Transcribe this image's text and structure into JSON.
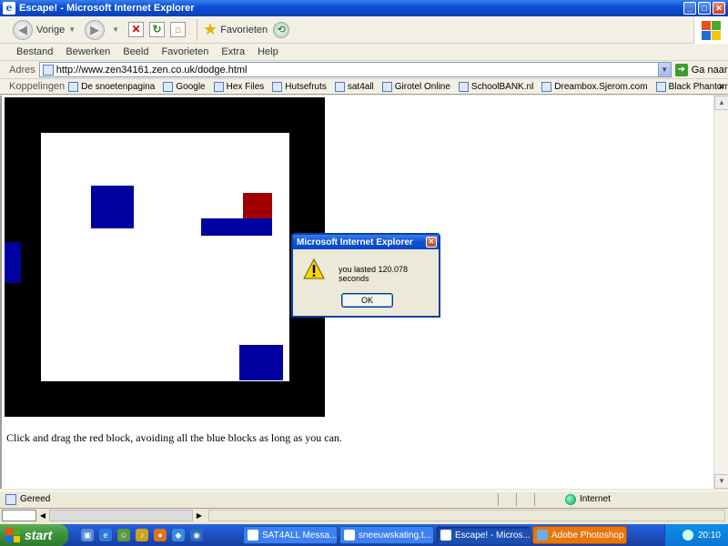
{
  "window": {
    "title": "Escape! - Microsoft Internet Explorer"
  },
  "toolbar": {
    "back_label": "Vorige",
    "favorites_label": "Favorieten"
  },
  "menu": [
    "Bestand",
    "Bewerken",
    "Beeld",
    "Favorieten",
    "Extra",
    "Help"
  ],
  "address": {
    "label": "Adres",
    "url": "http://www.zen34161.zen.co.uk/dodge.html",
    "go_label": "Ga naar"
  },
  "links": {
    "label": "Koppelingen",
    "items": [
      "De snoetenpagina",
      "Google",
      "Hex Files",
      "Hutsefruts",
      "sat4all",
      "Girotel Online",
      "SchoolBANK.nl",
      "Dreambox.Sjerom.com",
      "Black Phantom's Subtitles"
    ],
    "more": "»"
  },
  "page": {
    "instructions": "Click and drag the red block, avoiding all the blue blocks as long as you can."
  },
  "game": {
    "colors": {
      "frame": "#000000",
      "arena": "#ffffff",
      "enemy": "#0000a0",
      "player": "#a00000"
    }
  },
  "dialog": {
    "title": "Microsoft Internet Explorer",
    "message": "you lasted 120.078 seconds",
    "ok_label": "OK"
  },
  "status": {
    "text": "Gereed",
    "zone": "Internet"
  },
  "taskbar": {
    "start_label": "start",
    "tasks": [
      "SAT4ALL Messa...",
      "sneeuwskating.t...",
      "Escape! - Micros...",
      "Adobe Photoshop"
    ],
    "time": "20:10"
  }
}
